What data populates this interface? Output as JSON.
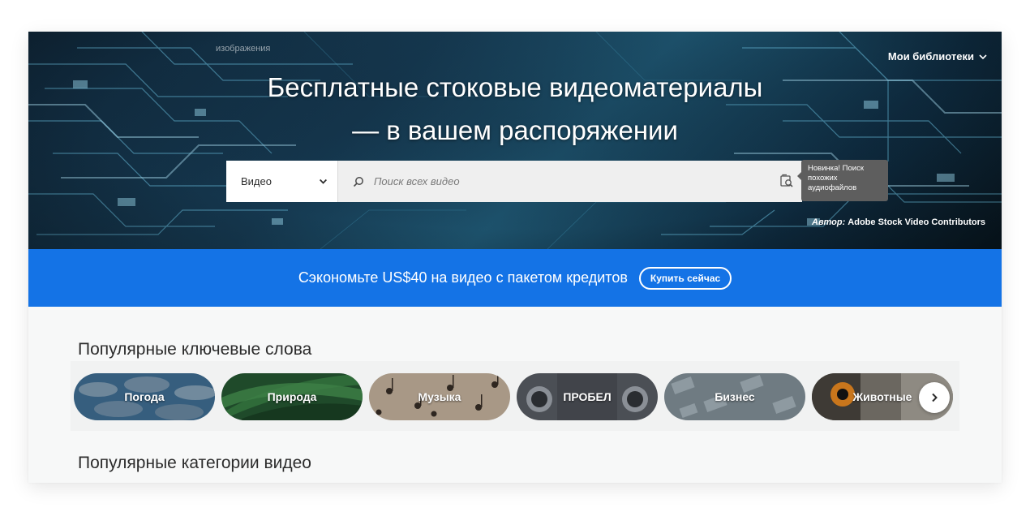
{
  "hero": {
    "breadcrumb": "изображения",
    "libraries_label": "Мои библиотеки",
    "title": "Бесплатные стоковые видеоматериалы\n— в вашем распоряжении",
    "search": {
      "type_label": "Видео",
      "placeholder": "Поиск всех видео"
    },
    "tooltip": "Новинка! Поиск похожих аудиофайлов",
    "author_label": "Автор:",
    "author_name": "Adobe Stock Video Contributors"
  },
  "promo": {
    "text": "Сэкономьте US$40 на видео с пакетом кредитов",
    "button": "Купить сейчас",
    "background_color": "#1473e6"
  },
  "keywords": {
    "title": "Популярные ключевые слова",
    "items": [
      {
        "label": "Погода"
      },
      {
        "label": "Природа"
      },
      {
        "label": "Музыка"
      },
      {
        "label": "ПРОБЕЛ"
      },
      {
        "label": "Бизнес"
      },
      {
        "label": "Животные"
      }
    ],
    "next_icon": "chevron-right-icon"
  },
  "categories": {
    "title": "Популярные категории видео"
  }
}
